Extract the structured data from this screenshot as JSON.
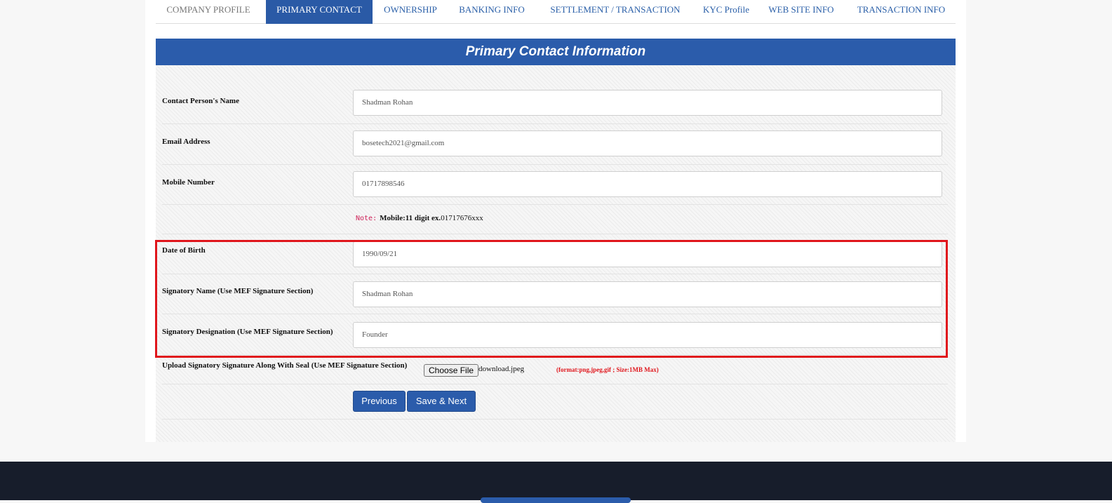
{
  "tabs": [
    {
      "label": "COMPANY PROFILE"
    },
    {
      "label": "PRIMARY CONTACT"
    },
    {
      "label": "OWNERSHIP"
    },
    {
      "label": "BANKING INFO"
    },
    {
      "label": "SETTLEMENT / TRANSACTION"
    },
    {
      "label": "KYC Profile"
    },
    {
      "label": "WEB SITE INFO"
    },
    {
      "label": "TRANSACTION INFO"
    }
  ],
  "panel": {
    "title": "Primary Contact Information"
  },
  "fields": {
    "contact_name": {
      "label": "Contact Person's Name",
      "value": "Shadman Rohan"
    },
    "email": {
      "label": "Email Address",
      "value": "bosetech2021@gmail.com"
    },
    "mobile": {
      "label": "Mobile Number",
      "value": "01717898546"
    },
    "dob": {
      "label": "Date of Birth",
      "value": "1990/09/21"
    },
    "signatory_name": {
      "label": "Signatory Name (Use MEF Signature Section)",
      "value": "Shadman Rohan"
    },
    "signatory_designation": {
      "label": "Signatory Designation (Use MEF Signature Section)",
      "value": "Founder"
    }
  },
  "note": {
    "tag": "Note:",
    "bold": "Mobile:11 digit ex.",
    "text": "01717676xxx"
  },
  "upload": {
    "label": "Upload Signatory Signature Along With Seal (Use MEF Signature Section)",
    "button": "Choose File",
    "filename": "download.jpeg",
    "format_note": "(format:png,jpeg,gif ; Size:1MB Max)"
  },
  "buttons": {
    "previous": "Previous",
    "save_next": "Save & Next"
  },
  "colors": {
    "primary": "#2b5cab",
    "highlight": "#e0161c",
    "footer": "#171d2b"
  }
}
